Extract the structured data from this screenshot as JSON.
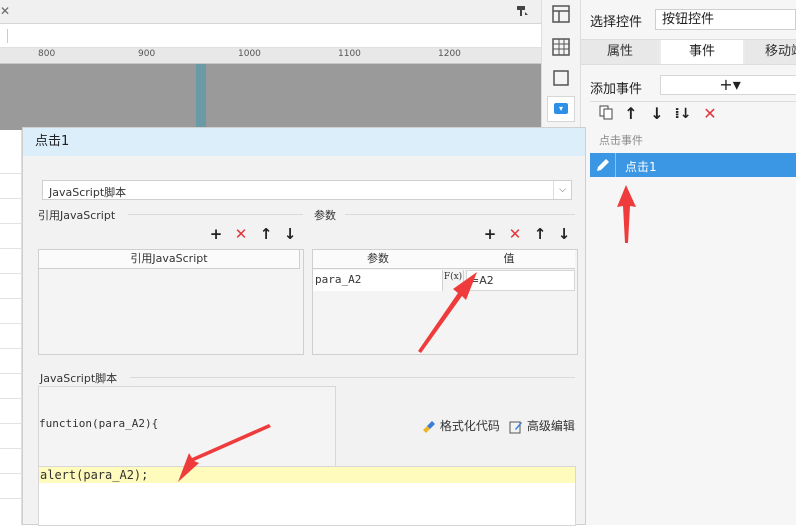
{
  "editor": {
    "ruler_ticks": [
      "800",
      "900",
      "1000",
      "1100",
      "1200"
    ]
  },
  "right_panel": {
    "select_label": "选择控件",
    "select_value": "按钮控件",
    "tabs": [
      {
        "label": "属性",
        "active": false
      },
      {
        "label": "事件",
        "active": true
      },
      {
        "label": "移动端",
        "active": false
      }
    ],
    "add_event_label": "添加事件",
    "add_symbol": "+▾",
    "section_label": "点击事件",
    "event_item": "点击1"
  },
  "dialog": {
    "title": "点击1",
    "type_select": "JavaScript脚本",
    "ref_js_group": "引用JavaScript",
    "ref_js_column": "引用JavaScript",
    "params_group": "参数",
    "params_columns": [
      "参数",
      "值"
    ],
    "params_rows": [
      {
        "name": "para_A2",
        "fx": "F(x)",
        "value": "=A2"
      }
    ],
    "script_group": "JavaScript脚本",
    "function_sig": "function(para_A2){",
    "format_code": "格式化代码",
    "advanced_edit": "高级编辑",
    "code_line": "alert(para_A2);"
  },
  "colors": {
    "accent_blue": "#3b96e4",
    "delete_red": "#e0353a",
    "arrow_red": "#ef3b3b",
    "code_highlight": "#fefbbd",
    "dialog_header": "#dbeef9"
  }
}
